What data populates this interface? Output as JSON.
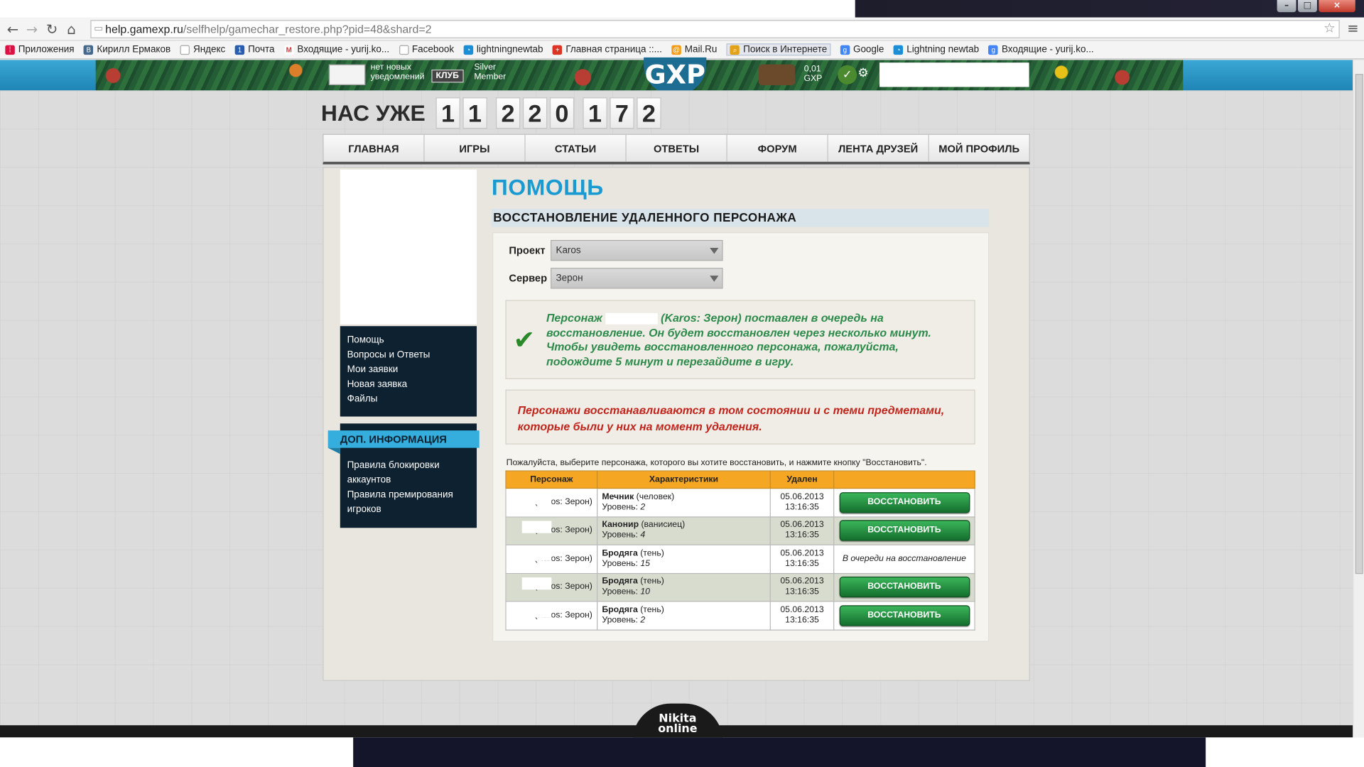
{
  "browser": {
    "url_host": "help.gamexp.ru",
    "url_path": "/selfhelp/gamechar_restore.php?pid=48&shard=2",
    "bookmarks": [
      "Приложения",
      "Кирилл Ермаков",
      "Яндекс",
      "Почта",
      "Входящие - yurij.ko...",
      "Facebook",
      "lightningnewtab",
      "Главная страница ::...",
      "Mail.Ru",
      "Поиск в Интернете",
      "Google",
      "Lightning newtab",
      "Входящие - yurij.ko..."
    ]
  },
  "site_header": {
    "notifications": "нет новых уведомлений",
    "club": "КЛУБ",
    "membership": "Silver Member",
    "logo": "GXP",
    "balance": "0,01",
    "currency": "GXP"
  },
  "counter": {
    "label": "НАС УЖЕ",
    "digits": [
      "1",
      "1",
      "2",
      "2",
      "0",
      "1",
      "7",
      "2"
    ]
  },
  "nav": [
    "ГЛАВНАЯ",
    "ИГРЫ",
    "СТАТЬИ",
    "ОТВЕТЫ",
    "ФОРУМ",
    "ЛЕНТА ДРУЗЕЙ",
    "МОЙ ПРОФИЛЬ"
  ],
  "sidebar": {
    "menu": [
      "Помощь",
      "Вопросы и Ответы",
      "Мои заявки",
      "Новая заявка",
      "Файлы"
    ],
    "extra_title": "ДОП. ИНФОРМАЦИЯ",
    "extra_links": [
      "Правила блокировки аккаунтов",
      "Правила премирования игроков"
    ]
  },
  "main": {
    "title": "ПОМОЩЬ",
    "section_title": "ВОССТАНОВЛЕНИЕ УДАЛЕННОГО ПЕРСОНАЖА",
    "project_label": "Проект",
    "project_value": "Karos",
    "server_label": "Сервер",
    "server_value": "Зерон",
    "success_prefix": "Персонаж",
    "success_text": "(Karos: Зерон) поставлен в очередь на восстановление.  Он будет восстановлен через несколько минут. Чтобы увидеть восстановленного персонажа, пожалуйста, подождите 5 минут и перезайдите в игру.",
    "warning": "Персонажи восстанавливаются в том состоянии и с теми предметами, которые были у них на момент удаления.",
    "instruction": "Пожалуйста, выберите персонажа, которого вы хотите восстановить, и нажмите кнопку \"Восстановить\"."
  },
  "table": {
    "headers": [
      "Персонаж",
      "Характеристики",
      "Удален",
      ""
    ],
    "level_label": "Уровень:",
    "rows": [
      {
        "name": "(Karos: Зерон)",
        "class": "Мечник",
        "race": "(человек)",
        "level": "2",
        "date": "05.06.2013",
        "time": "13:16:35",
        "action": "ВОССТАНОВИТЬ",
        "queued": false
      },
      {
        "name": "(Karos: Зерон)",
        "class": "Канонир",
        "race": "(ванисиец)",
        "level": "4",
        "date": "05.06.2013",
        "time": "13:16:35",
        "action": "ВОССТАНОВИТЬ",
        "queued": false
      },
      {
        "name": "(Karos: Зерон)",
        "class": "Бродяга",
        "race": "(тень)",
        "level": "15",
        "date": "05.06.2013",
        "time": "13:16:35",
        "action": "В очереди на восстановление",
        "queued": true
      },
      {
        "name": "(Karos: Зерон)",
        "class": "Бродяга",
        "race": "(тень)",
        "level": "10",
        "date": "05.06.2013",
        "time": "13:16:35",
        "action": "ВОССТАНОВИТЬ",
        "queued": false
      },
      {
        "name": "(Karos: Зерон)",
        "class": "Бродяга",
        "race": "(тень)",
        "level": "2",
        "date": "05.06.2013",
        "time": "13:16:35",
        "action": "ВОССТАНОВИТЬ",
        "queued": false
      }
    ]
  },
  "footer": {
    "logo_line1": "Nikita",
    "logo_line2": "online"
  }
}
